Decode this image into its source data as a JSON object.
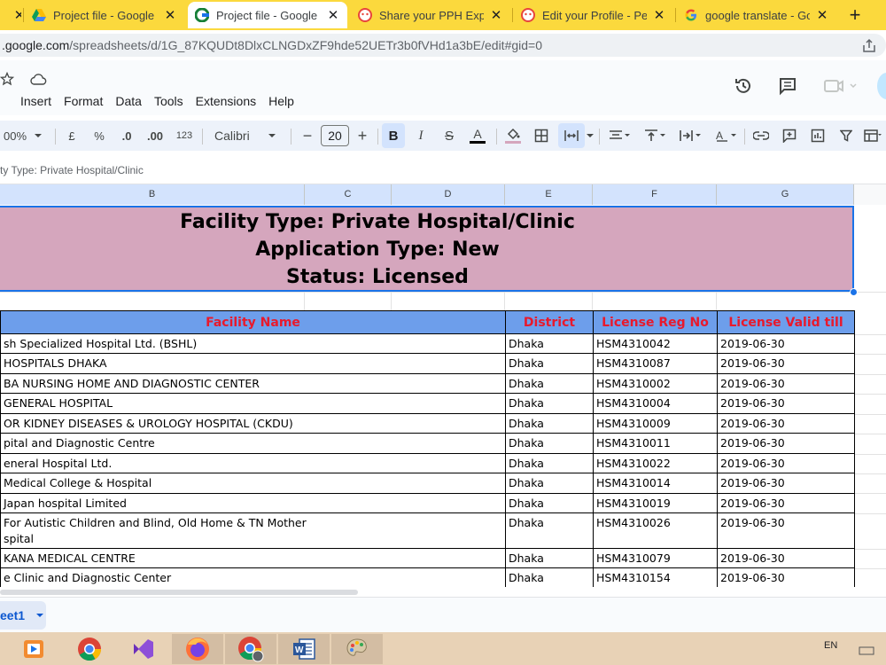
{
  "browser": {
    "tabs": [
      {
        "title": "",
        "active": false
      },
      {
        "title": "Project file - Google Dr",
        "active": false
      },
      {
        "title": "Project file - Google Sh",
        "active": true
      },
      {
        "title": "Share your PPH Experti",
        "active": false
      },
      {
        "title": "Edit your Profile - Peop",
        "active": false
      },
      {
        "title": "google translate - Goo",
        "active": false
      }
    ],
    "url_host": ".google.com",
    "url_path": "/spreadsheets/d/1G_87KQUDt8DlxCLNGDxZF9hde52UETr3b0fVHd1a3bE/edit#gid=0"
  },
  "menu": [
    "Insert",
    "Format",
    "Data",
    "Tools",
    "Extensions",
    "Help"
  ],
  "toolbar": {
    "zoom": "00%",
    "currency": "£",
    "percent": "%",
    "decrease_decimal": ".0",
    "increase_decimal": ".00",
    "number_format": "123",
    "font": "Calibri",
    "font_size": "20"
  },
  "formula_bar": {
    "content": "ty Type: Private Hospital/Clinic"
  },
  "columns": [
    "B",
    "C",
    "D",
    "E",
    "F",
    "G"
  ],
  "banner": {
    "line1": "Facility Type: Private Hospital/Clinic",
    "line2": "Application Type: New",
    "line3": "Status: Licensed"
  },
  "table": {
    "headers": [
      "Facility Name",
      "District",
      "License Reg No",
      "License Valid till"
    ],
    "rows": [
      {
        "name": "sh Specialized Hospital Ltd. (BSHL)",
        "district": "Dhaka",
        "reg": "HSM4310042",
        "valid": "2019-06-30"
      },
      {
        "name": "HOSPITALS DHAKA",
        "district": "Dhaka",
        "reg": "HSM4310087",
        "valid": "2019-06-30"
      },
      {
        "name": "BA NURSING HOME AND DIAGNOSTIC CENTER",
        "district": "Dhaka",
        "reg": "HSM4310002",
        "valid": "2019-06-30"
      },
      {
        "name": " GENERAL HOSPITAL",
        "district": "Dhaka",
        "reg": "HSM4310004",
        "valid": "2019-06-30"
      },
      {
        "name": "OR KIDNEY DISEASES & UROLOGY HOSPITAL (CKDU)",
        "district": "Dhaka",
        "reg": "HSM4310009",
        "valid": "2019-06-30"
      },
      {
        "name": "pital and Diagnostic Centre",
        "district": "Dhaka",
        "reg": "HSM4310011",
        "valid": "2019-06-30"
      },
      {
        "name": "eneral Hospital Ltd.",
        "district": "Dhaka",
        "reg": "HSM4310022",
        "valid": "2019-06-30"
      },
      {
        "name": " Medical College & Hospital",
        "district": "Dhaka",
        "reg": "HSM4310014",
        "valid": "2019-06-30"
      },
      {
        "name": " Japan hospital Limited",
        "district": "Dhaka",
        "reg": "HSM4310019",
        "valid": "2019-06-30"
      },
      {
        "name": "For Autistic Children and Blind, Old Home & TN Mother",
        "name2": "spital",
        "district": "Dhaka",
        "reg": "HSM4310026",
        "valid": "2019-06-30"
      },
      {
        "name": "KANA MEDICAL CENTRE",
        "district": "Dhaka",
        "reg": "HSM4310079",
        "valid": "2019-06-30"
      },
      {
        "name": "e Clinic and Diagnostic Center",
        "district": "Dhaka",
        "reg": "HSM4310154",
        "valid": "2019-06-30"
      }
    ]
  },
  "sheet_tab": "eet1",
  "taskbar": {
    "lang": "EN"
  },
  "colors": {
    "tab_strip": "#fbd93d",
    "header_fill": "#6d9eeb",
    "header_text": "#e8192c",
    "banner_fill": "#d5a6bd",
    "selection": "#1a73e8"
  }
}
